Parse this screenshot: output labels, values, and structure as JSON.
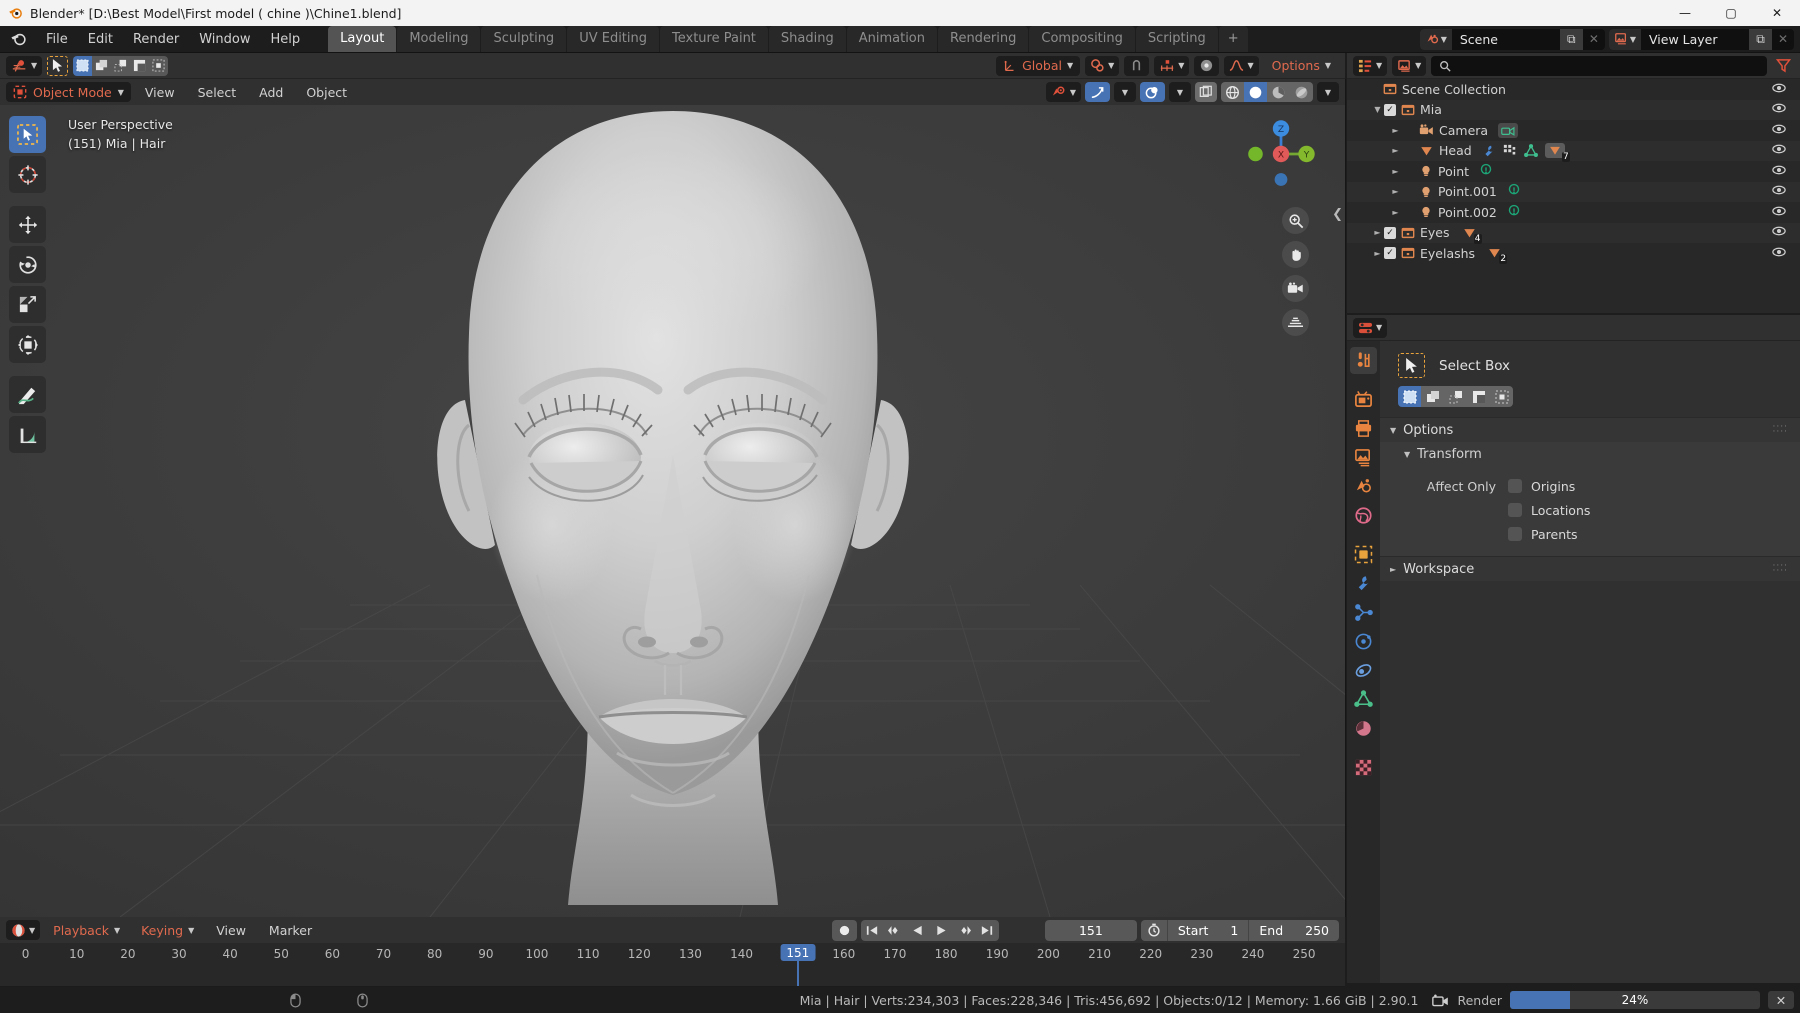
{
  "window": {
    "title": "Blender* [D:\\Best Model\\First model ( chine )\\Chine1.blend]",
    "controls": {
      "minimize": "—",
      "maximize": "▢",
      "close": "✕"
    }
  },
  "topbar": {
    "menus": [
      "File",
      "Edit",
      "Render",
      "Window",
      "Help"
    ],
    "workspaces": [
      "Layout",
      "Modeling",
      "Sculpting",
      "UV Editing",
      "Texture Paint",
      "Shading",
      "Animation",
      "Rendering",
      "Compositing",
      "Scripting"
    ],
    "active_workspace": "Layout",
    "add_workspace": "+",
    "scene": {
      "name": "Scene",
      "new_label": "⧉",
      "delete_label": "✕"
    },
    "view_layer": {
      "name": "View Layer",
      "new_label": "⧉",
      "delete_label": "✕"
    }
  },
  "tool_settings": {
    "transform_orientation": "Global",
    "options_label": "Options"
  },
  "viewport": {
    "mode": "Object Mode",
    "menus": [
      "View",
      "Select",
      "Add",
      "Object"
    ],
    "overlay_text_line1": "User Perspective",
    "overlay_text_line2": "(151) Mia | Hair",
    "gizmo_axes": {
      "x": "X",
      "y": "Y",
      "z": "Z"
    },
    "active_tool": "select-box"
  },
  "outliner": {
    "search_placeholder": "",
    "rows": [
      {
        "label": "Scene Collection",
        "indent": 0,
        "type": "collection",
        "disclosure": "",
        "checkbox": false,
        "badge": ""
      },
      {
        "label": "Mia",
        "indent": 1,
        "type": "collection",
        "disclosure": "▼",
        "checkbox": true,
        "badge": ""
      },
      {
        "label": "Camera",
        "indent": 2,
        "type": "camera",
        "disclosure": "►",
        "checkbox": false,
        "badge": ""
      },
      {
        "label": "Head",
        "indent": 2,
        "type": "mesh",
        "disclosure": "►",
        "checkbox": false,
        "badge": "7"
      },
      {
        "label": "Point",
        "indent": 2,
        "type": "light",
        "disclosure": "►",
        "checkbox": false,
        "badge": ""
      },
      {
        "label": "Point.001",
        "indent": 2,
        "type": "light",
        "disclosure": "►",
        "checkbox": false,
        "badge": ""
      },
      {
        "label": "Point.002",
        "indent": 2,
        "type": "light",
        "disclosure": "►",
        "checkbox": false,
        "badge": ""
      },
      {
        "label": "Eyes",
        "indent": 1,
        "type": "collection",
        "disclosure": "►",
        "checkbox": true,
        "badge": "4"
      },
      {
        "label": "Eyelashs",
        "indent": 1,
        "type": "collection",
        "disclosure": "►",
        "checkbox": true,
        "badge": "2"
      }
    ]
  },
  "properties": {
    "tool_name": "Select Box",
    "panels": {
      "options": "Options",
      "transform": "Transform",
      "workspace": "Workspace"
    },
    "affect_only_label": "Affect Only",
    "affect_only_options": [
      "Origins",
      "Locations",
      "Parents"
    ]
  },
  "timeline": {
    "menus_red": [
      "Playback",
      "Keying"
    ],
    "menus": [
      "View",
      "Marker"
    ],
    "current_frame": "151",
    "start_label": "Start",
    "start_value": "1",
    "end_label": "End",
    "end_value": "250",
    "ticks": [
      0,
      10,
      20,
      30,
      40,
      50,
      60,
      70,
      80,
      90,
      100,
      110,
      120,
      130,
      140,
      150,
      160,
      170,
      180,
      190,
      200,
      210,
      220,
      230,
      240,
      250
    ],
    "playhead_frame": 151,
    "range": [
      -5,
      258
    ]
  },
  "statusbar": {
    "stats": "Mia | Hair | Verts:234,303 | Faces:228,346 | Tris:456,692 | Objects:0/12 | Memory: 1.66 GiB | 2.90.1",
    "render_label": "Render",
    "render_percent": "24%",
    "render_progress": 24,
    "cancel_label": "✕"
  },
  "colors": {
    "accent_blue": "#4772b3",
    "accent_orange": "#e06a4e",
    "collection_orange": "#e0864f",
    "mesh_green": "#4bbf8a",
    "light_green": "#1ca376",
    "bg_dark": "#1d1d1d",
    "bg_panel": "#303030",
    "viewport_bg": "#3a3a3a"
  }
}
